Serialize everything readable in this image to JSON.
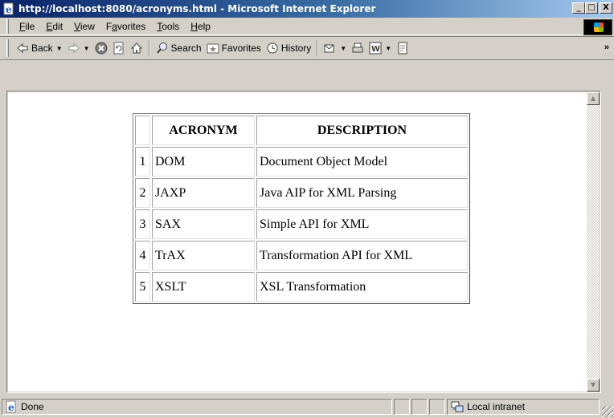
{
  "window": {
    "title": "http://localhost:8080/acronyms.html - Microsoft Internet Explorer",
    "minimize": "_",
    "maximize": "□",
    "close": "X"
  },
  "menu": {
    "items": [
      {
        "label": "File",
        "accel": "F",
        "rest": "ile"
      },
      {
        "label": "Edit",
        "accel": "E",
        "rest": "dit"
      },
      {
        "label": "View",
        "accel": "V",
        "rest": "iew"
      },
      {
        "label": "Favorites",
        "pre": "F",
        "accel": "a",
        "rest": "vorites"
      },
      {
        "label": "Tools",
        "accel": "T",
        "rest": "ools"
      },
      {
        "label": "Help",
        "accel": "H",
        "rest": "elp"
      }
    ]
  },
  "toolbar": {
    "back": "Back",
    "search": "Search",
    "favorites": "Favorites",
    "history": "History",
    "more": "»"
  },
  "table": {
    "headers": {
      "acronym": "ACRONYM",
      "description": "DESCRIPTION"
    },
    "rows": [
      {
        "num": "1",
        "acronym": "DOM",
        "description": "Document Object Model"
      },
      {
        "num": "2",
        "acronym": "JAXP",
        "description": "Java AIP for XML Parsing"
      },
      {
        "num": "3",
        "acronym": "SAX",
        "description": "Simple API for XML"
      },
      {
        "num": "4",
        "acronym": "TrAX",
        "description": "Transformation API for XML"
      },
      {
        "num": "5",
        "acronym": "XSLT",
        "description": "XSL Transformation"
      }
    ]
  },
  "status": {
    "text": "Done",
    "zone": "Local intranet"
  },
  "icons": {
    "app": "ie-page-icon",
    "back": "back-arrow-icon",
    "forward": "forward-arrow-icon",
    "stop": "stop-icon",
    "refresh": "refresh-icon",
    "home": "home-icon",
    "search": "search-icon",
    "favorites": "favorites-icon",
    "history": "history-icon",
    "mail": "mail-icon",
    "print": "print-icon",
    "edit": "edit-icon",
    "discuss": "discuss-icon"
  },
  "colors": {
    "titlebar_start": "#0a246a",
    "titlebar_end": "#a6caf0",
    "chrome": "#d4d0c8"
  }
}
